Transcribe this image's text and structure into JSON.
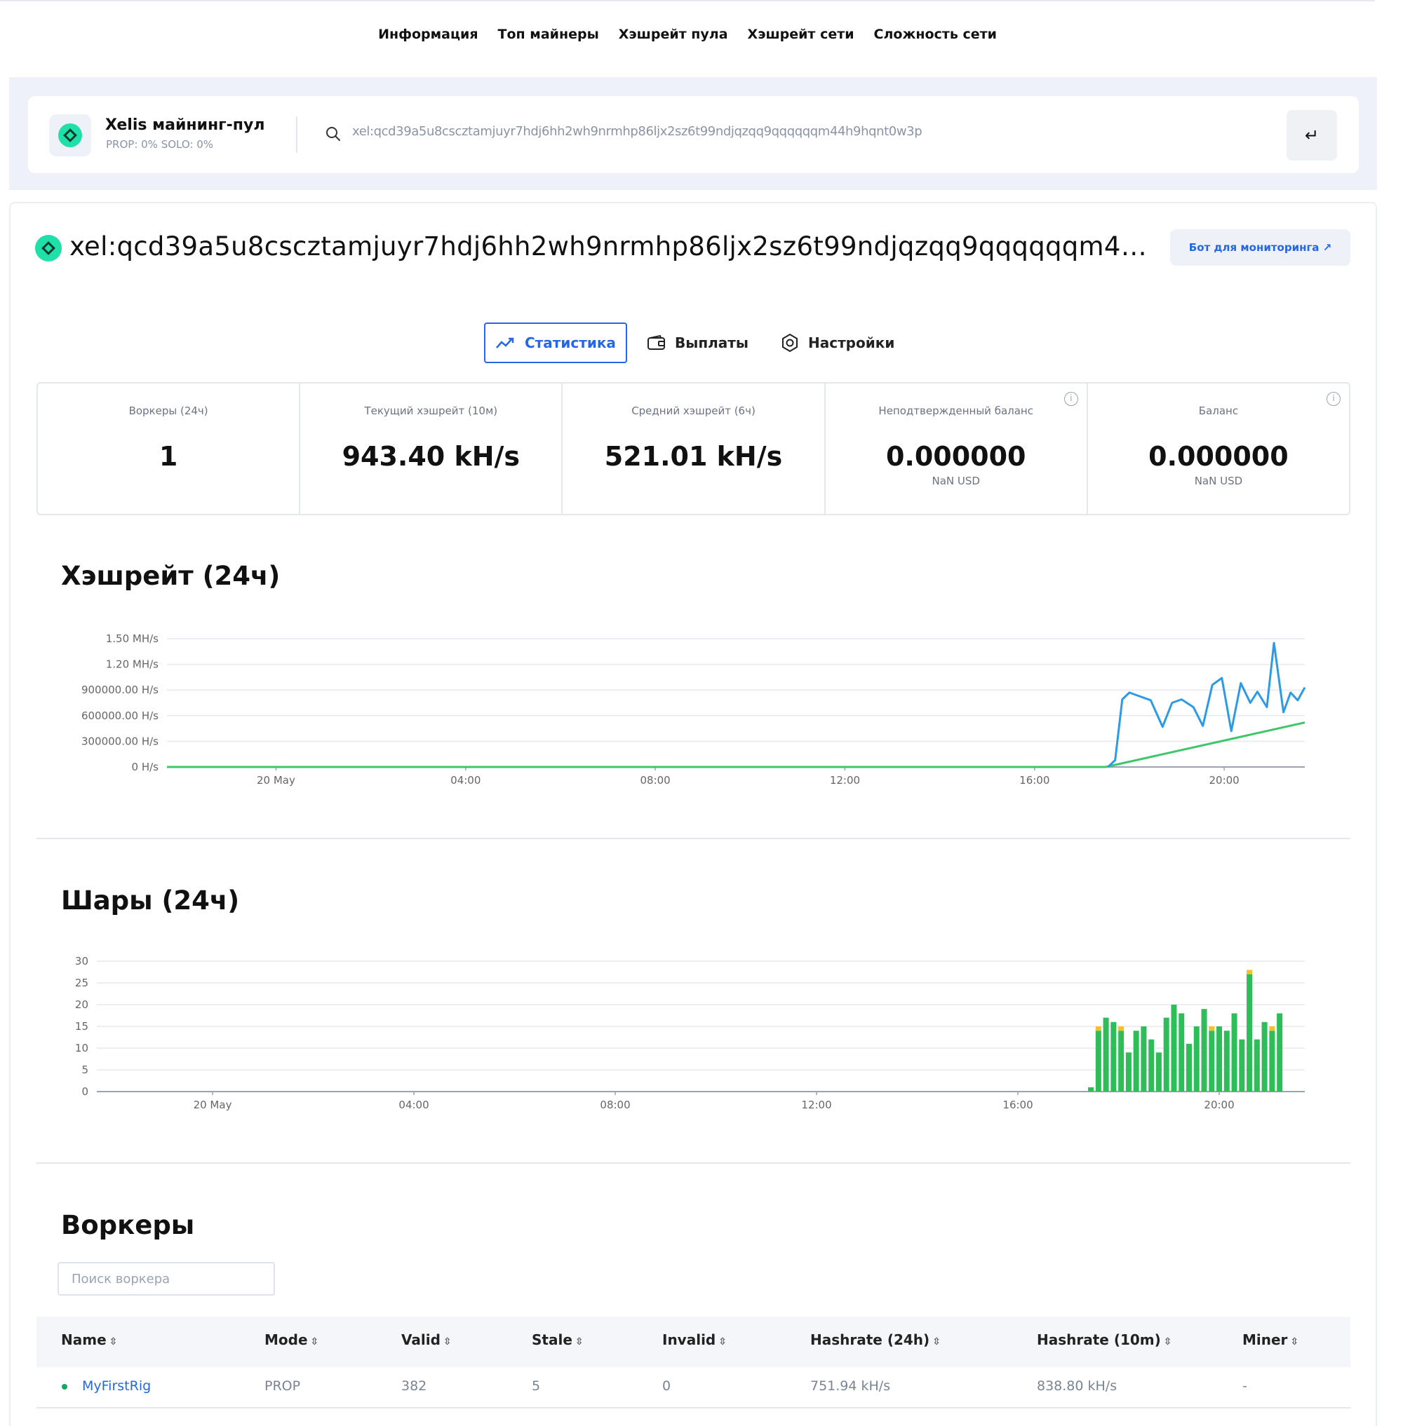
{
  "topnav": {
    "items": [
      "Информация",
      "Топ майнеры",
      "Хэшрейт пула",
      "Хэшрейт сети",
      "Сложность сети"
    ]
  },
  "search": {
    "pool_name": "Xelis майнинг-пул",
    "pool_fee": "PROP: 0% SOLO: 0%",
    "value": "xel:qcd39a5u8csczt­amjuyr7hdj6hh2wh9nrmhp86ljx2sz6t99ndjqzqq9qqqqqqm44h9hqnt0w3p",
    "enter_icon": "enter-icon"
  },
  "account": {
    "address": "xel:qcd39a5u8csczt­amjuyr7hdj6hh2wh9nrmhp86ljx2sz6t99ndjqzqq9qqqqqqm44h9hqnt0w3p",
    "bot_link": "Бот для мониторинга ↗"
  },
  "tabs": [
    {
      "label": "Статистика",
      "icon": "chart-line-icon",
      "active": true
    },
    {
      "label": "Выплаты",
      "icon": "wallet-icon",
      "active": false
    },
    {
      "label": "Настройки",
      "icon": "gear-icon",
      "active": false
    }
  ],
  "stats": [
    {
      "label": "Воркеры (24ч)",
      "value": "1",
      "sub": ""
    },
    {
      "label": "Текущий хэшрейт (10м)",
      "value": "943.40 kH/s",
      "sub": ""
    },
    {
      "label": "Средний хэшрейт (6ч)",
      "value": "521.01 kH/s",
      "sub": ""
    },
    {
      "label": "Неподтвержденный баланс",
      "value": "0.000000",
      "sub": "NaN USD"
    },
    {
      "label": "Баланс",
      "value": "0.000000",
      "sub": "NaN USD"
    }
  ],
  "colors": {
    "accent": "#2468e8",
    "line_blue": "#2b9be6",
    "line_green": "#3dc76a",
    "bar_green": "#2ebd59",
    "bar_yellow": "#f2c12e",
    "coin": "#1ee0a8"
  },
  "chart_data": [
    {
      "type": "line",
      "title": "Хэшрейт (24ч)",
      "x_ticks": [
        "20 May",
        "04:00",
        "08:00",
        "12:00",
        "16:00",
        "20:00"
      ],
      "y_ticks": [
        "0 H/s",
        "300000.00 H/s",
        "600000.00 H/s",
        "900000.00 H/s",
        "1.20 MH/s",
        "1.50 MH/s"
      ],
      "ylim": [
        0,
        1500000
      ],
      "xlim": [
        -2.3,
        21.7
      ],
      "grid": true,
      "series": [
        {
          "x": [
            17.55,
            17.7,
            17.85,
            18.0,
            18.2,
            18.45,
            18.7,
            18.9,
            19.1,
            19.35,
            19.55,
            19.75,
            19.95,
            20.15,
            20.35,
            20.55,
            20.7,
            20.9,
            21.05,
            21.25,
            21.4,
            21.55,
            21.7
          ],
          "y": [
            0,
            80000,
            790000,
            870000,
            830000,
            780000,
            470000,
            750000,
            790000,
            700000,
            480000,
            960000,
            1040000,
            420000,
            980000,
            750000,
            880000,
            700000,
            1450000,
            640000,
            870000,
            780000,
            930000
          ]
        },
        {
          "x": [
            17.5,
            21.7
          ],
          "y": [
            0,
            520000
          ]
        }
      ]
    },
    {
      "type": "bar",
      "title": "Шары (24ч)",
      "x_ticks": [
        "20 May",
        "04:00",
        "08:00",
        "12:00",
        "16:00",
        "20:00"
      ],
      "y_ticks": [
        "0",
        "5",
        "10",
        "15",
        "20",
        "25",
        "30"
      ],
      "ylim": [
        0,
        30
      ],
      "xlim": [
        -2.3,
        21.7
      ],
      "grid": true,
      "x": [
        17.45,
        17.6,
        17.75,
        17.9,
        18.05,
        18.2,
        18.35,
        18.5,
        18.65,
        18.8,
        18.95,
        19.1,
        19.25,
        19.4,
        19.55,
        19.7,
        19.85,
        20.0,
        20.15,
        20.3,
        20.45,
        20.6,
        20.75,
        20.9,
        21.05,
        21.2,
        21.35,
        21.5,
        21.65
      ],
      "series": [
        {
          "values": [
            1,
            14,
            17,
            16,
            14,
            9,
            14,
            15,
            12,
            9,
            17,
            20,
            18,
            11,
            15,
            19,
            14,
            15,
            14,
            18,
            12,
            27,
            12,
            16,
            14,
            18,
            0,
            0,
            0
          ],
          "color": "#2ebd59"
        },
        {
          "values": [
            0,
            1,
            0,
            0,
            1,
            0,
            0,
            0,
            0,
            0,
            0,
            0,
            0,
            0,
            0,
            0,
            1,
            0,
            0,
            0,
            0,
            1,
            0,
            0,
            1,
            0,
            0,
            0,
            0
          ],
          "color": "#f2c12e"
        }
      ]
    }
  ],
  "sections": {
    "hashrate_title": "Хэшрейт (24ч)",
    "shares_title": "Шары (24ч)",
    "workers_title": "Воркеры"
  },
  "workers": {
    "search_placeholder": "Поиск воркера",
    "columns": [
      "Name",
      "Mode",
      "Valid",
      "Stale",
      "Invalid",
      "Hashrate (24h)",
      "Hashrate (10m)",
      "Miner"
    ],
    "rows": [
      {
        "name": "MyFirstRig",
        "mode": "PROP",
        "valid": "382",
        "stale": "5",
        "invalid": "0",
        "hr24": "751.94 kH/s",
        "hr10": "838.80 kH/s",
        "miner": "-"
      }
    ]
  }
}
